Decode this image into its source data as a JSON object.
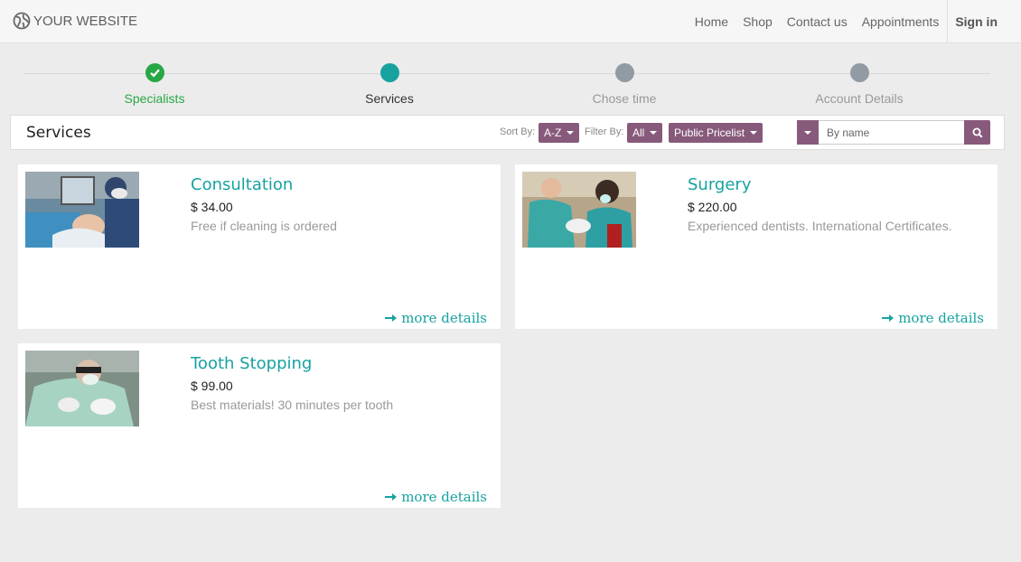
{
  "brand": {
    "name": "YOUR WEBSITE",
    "icon": "globe-icon"
  },
  "nav": {
    "items": [
      "Home",
      "Shop",
      "Contact us",
      "Appointments"
    ],
    "signin": "Sign in"
  },
  "steps": [
    {
      "label": "Specialists",
      "state": "done"
    },
    {
      "label": "Services",
      "state": "active"
    },
    {
      "label": "Chose time",
      "state": "todo"
    },
    {
      "label": "Account Details",
      "state": "todo"
    }
  ],
  "toolbar": {
    "title": "Services",
    "sort_label": "Sort By:",
    "sort_value": "A-Z",
    "filter_label": "Filter By:",
    "filter_value": "All",
    "pricelist": "Public Pricelist",
    "search_placeholder": "By name"
  },
  "services": [
    {
      "name": "Consultation",
      "price": "$ 34.00",
      "desc": "Free if cleaning is ordered",
      "more": "more details"
    },
    {
      "name": "Surgery",
      "price": "$ 220.00",
      "desc": "Experienced dentists. International Certificates.",
      "more": "more details"
    },
    {
      "name": "Tooth Stopping",
      "price": "$ 99.00",
      "desc": "Best materials! 30 minutes per tooth",
      "more": "more details"
    }
  ],
  "colors": {
    "accent": "#875a7b",
    "teal": "#17a2a0",
    "success": "#28a745",
    "inactive": "#929aa3"
  }
}
